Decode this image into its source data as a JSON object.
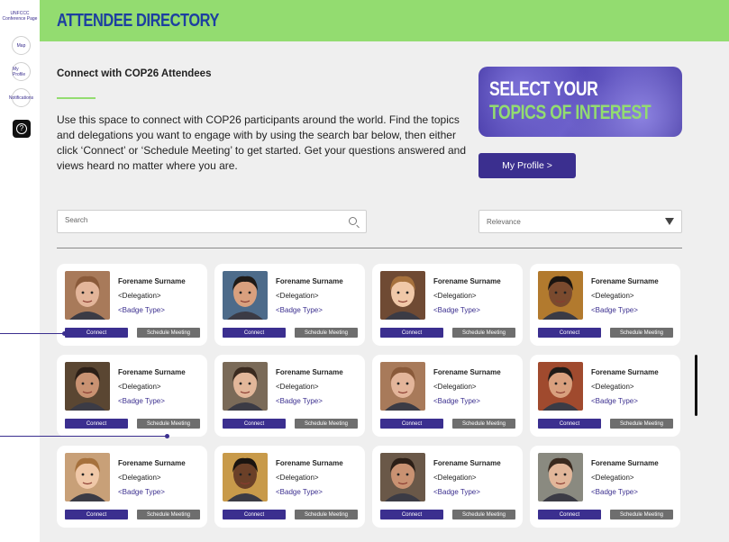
{
  "rail": {
    "conference_label": "UNFCCC Conference Page",
    "map_label": "Map",
    "profile_label": "My Profile",
    "notifications_label": "Notifications",
    "help_icon": "question-mark-icon"
  },
  "header": {
    "title": "ATTENDEE DIRECTORY"
  },
  "intro": {
    "subtitle": "Connect with COP26 Attendees",
    "body": "Use this space to connect with COP26 participants around the world. Find the topics and delegations you want to engage with by using the search bar below, then either click ‘Connect’ or ‘Schedule Meeting’ to get started. Get your questions answered and views heard no matter where you are."
  },
  "banner": {
    "line1": "SELECT YOUR",
    "line2": "TOPICS OF INTEREST"
  },
  "profile_button": "My Profile >",
  "search": {
    "placeholder": "Search",
    "icon": "search-icon"
  },
  "sort": {
    "value": "Relevance"
  },
  "card_labels": {
    "connect": "Connect",
    "schedule": "Schedule Meeting"
  },
  "attendees": [
    {
      "name": "Forename Surname",
      "delegation": "<Delegation>",
      "badge": "<Badge Type>"
    },
    {
      "name": "Forename Surname",
      "delegation": "<Delegation>",
      "badge": "<Badge Type>"
    },
    {
      "name": "Forename Surname",
      "delegation": "<Delegation>",
      "badge": "<Badge Type>"
    },
    {
      "name": "Forename Surname",
      "delegation": "<Delegation>",
      "badge": "<Badge Type>"
    },
    {
      "name": "Forename Surname",
      "delegation": "<Delegation>",
      "badge": "<Badge Type>"
    },
    {
      "name": "Forename Surname",
      "delegation": "<Delegation>",
      "badge": "<Badge Type>"
    },
    {
      "name": "Forename Surname",
      "delegation": "<Delegation>",
      "badge": "<Badge Type>"
    },
    {
      "name": "Forename Surname",
      "delegation": "<Delegation>",
      "badge": "<Badge Type>"
    },
    {
      "name": "Forename Surname",
      "delegation": "<Delegation>",
      "badge": "<Badge Type>"
    },
    {
      "name": "Forename Surname",
      "delegation": "<Delegation>",
      "badge": "<Badge Type>"
    },
    {
      "name": "Forename Surname",
      "delegation": "<Delegation>",
      "badge": "<Badge Type>"
    },
    {
      "name": "Forename Surname",
      "delegation": "<Delegation>",
      "badge": "<Badge Type>"
    }
  ],
  "colors": {
    "header_bg": "#93dc70",
    "title": "#1d3fa0",
    "primary": "#3b2f8f",
    "secondary_button": "#6e6e6e",
    "page_bg": "#efefef"
  }
}
